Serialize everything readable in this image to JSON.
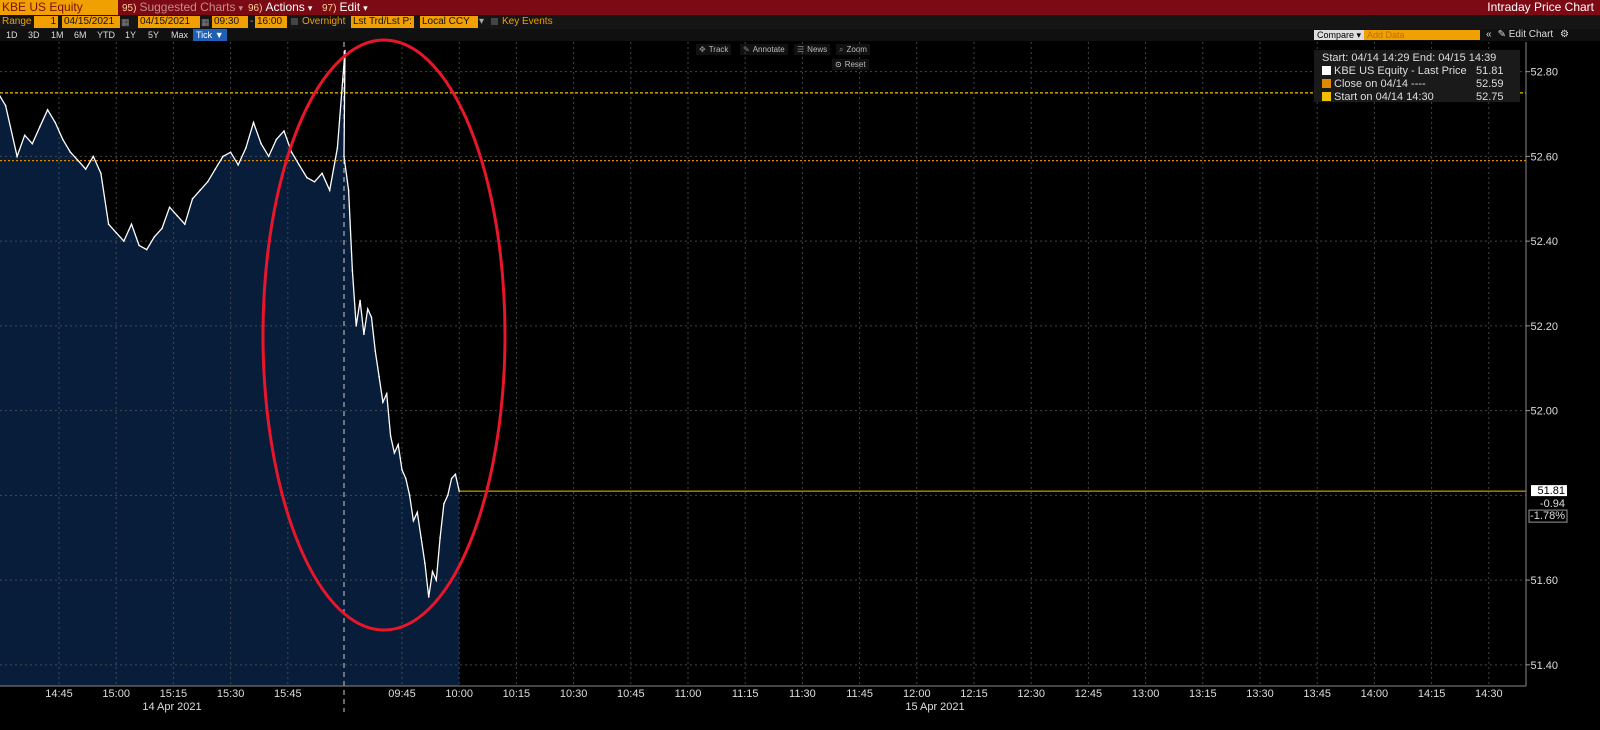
{
  "header": {
    "ticker": "KBE US Equity",
    "suggested_label": "Suggested Charts",
    "suggested_num": "95)",
    "actions_num": "96)",
    "actions_label": "Actions",
    "edit_num": "97)",
    "edit_label": "Edit",
    "app_title": "Intraday Price Chart"
  },
  "range_bar": {
    "range_label": "Range",
    "range_value": "1",
    "start_date": "04/15/2021",
    "end_date": "04/15/2021",
    "start_time": "09:30",
    "end_time": "16:00",
    "overnight_label": "Overnight",
    "field": "Lst Trd/Lst P:",
    "currency": "Local CCY",
    "key_events_label": "Key Events"
  },
  "period_buttons": [
    "1D",
    "3D",
    "1M",
    "6M",
    "YTD",
    "1Y",
    "5Y",
    "Max",
    "Tick"
  ],
  "selected_period": "Tick",
  "toolbar": {
    "compare_label": "Compare",
    "add_data_placeholder": "Add Data",
    "edit_chart_label": "Edit Chart"
  },
  "tools": [
    "Track",
    "Annotate",
    "News",
    "Zoom",
    "Reset"
  ],
  "legend": {
    "header": "Start: 04/14 14:29 End: 04/15 14:39",
    "rows": [
      {
        "label": "KBE US Equity - Last Price",
        "value": "51.81",
        "color": "#ffffff"
      },
      {
        "label": "Close on 04/14 ----",
        "value": "52.59",
        "color": "#e08a00"
      },
      {
        "label": "Start on 04/14 14:30",
        "value": "52.75",
        "color": "#f0c000"
      }
    ]
  },
  "chart_data": {
    "type": "area",
    "title": "",
    "xlabel": "",
    "ylabel": "",
    "ylim": [
      51.35,
      52.87
    ],
    "y_ticks": [
      "52.80",
      "52.60",
      "52.40",
      "52.20",
      "52.00",
      "51.60",
      "51.40"
    ],
    "x_ticks_day1": [
      "14:45",
      "15:00",
      "15:15",
      "15:30",
      "15:45"
    ],
    "x_ticks_day2": [
      "09:45",
      "10:00",
      "10:15",
      "10:30",
      "10:45",
      "11:00",
      "11:15",
      "11:30",
      "11:45",
      "12:00",
      "12:15",
      "12:30",
      "12:45",
      "13:00",
      "13:15",
      "13:30",
      "13:45",
      "14:00",
      "14:15",
      "14:30"
    ],
    "date_labels": [
      "14 Apr 2021",
      "15 Apr 2021"
    ],
    "series": [
      {
        "name": "KBE US Equity - Last Price",
        "day": "04/14",
        "x": [
          "14:29",
          "14:31",
          "14:34",
          "14:36",
          "14:38",
          "14:40",
          "14:42",
          "14:44",
          "14:46",
          "14:48",
          "14:50",
          "14:52",
          "14:54",
          "14:56",
          "14:58",
          "15:00",
          "15:02",
          "15:04",
          "15:06",
          "15:08",
          "15:10",
          "15:12",
          "15:14",
          "15:16",
          "15:18",
          "15:20",
          "15:22",
          "15:24",
          "15:26",
          "15:28",
          "15:30",
          "15:32",
          "15:34",
          "15:36",
          "15:38",
          "15:40",
          "15:42",
          "15:44",
          "15:46",
          "15:48",
          "15:50",
          "15:52",
          "15:54",
          "15:56",
          "15:58",
          "16:00"
        ],
        "values": [
          52.75,
          52.72,
          52.6,
          52.65,
          52.63,
          52.67,
          52.71,
          52.68,
          52.64,
          52.61,
          52.59,
          52.57,
          52.6,
          52.56,
          52.44,
          52.42,
          52.4,
          52.44,
          52.39,
          52.38,
          52.41,
          52.43,
          52.48,
          52.46,
          52.44,
          52.5,
          52.52,
          52.54,
          52.57,
          52.6,
          52.61,
          52.58,
          52.62,
          52.68,
          52.63,
          52.6,
          52.64,
          52.66,
          52.61,
          52.58,
          52.55,
          52.54,
          52.56,
          52.52,
          52.62,
          52.85
        ]
      },
      {
        "name": "KBE US Equity - Last Price",
        "day": "04/15",
        "x": [
          "09:30",
          "09:31",
          "09:32",
          "09:33",
          "09:34",
          "09:35",
          "09:36",
          "09:37",
          "09:38",
          "09:39",
          "09:40",
          "09:41",
          "09:42",
          "09:43",
          "09:44",
          "09:45",
          "09:46",
          "09:47",
          "09:48",
          "09:49",
          "09:50",
          "09:51",
          "09:52",
          "09:53",
          "09:54",
          "09:55",
          "09:56",
          "09:57",
          "09:58",
          "09:59",
          "10:00"
        ],
        "values": [
          52.6,
          52.52,
          52.33,
          52.2,
          52.26,
          52.18,
          52.24,
          52.22,
          52.14,
          52.08,
          52.02,
          52.04,
          51.94,
          51.9,
          51.92,
          51.86,
          51.84,
          51.8,
          51.74,
          51.76,
          51.7,
          51.64,
          51.56,
          51.62,
          51.6,
          51.7,
          51.78,
          51.8,
          51.84,
          51.85,
          51.81
        ]
      }
    ],
    "reference_lines": [
      {
        "label": "Start on 04/14 14:30",
        "value": 52.75
      },
      {
        "label": "Close on 04/14",
        "value": 52.59
      },
      {
        "label": "Last Price",
        "value": 51.81
      }
    ],
    "price_tags": [
      "51.81",
      "-0.94",
      "-1.78%"
    ],
    "colors": {
      "area": "#071d3a",
      "line": "#ffffff",
      "start_line": "#f0c000",
      "close_line": "#e08a00",
      "last_line": "#f0c000",
      "highlight": "#e8162a",
      "grid": "#555555"
    }
  }
}
